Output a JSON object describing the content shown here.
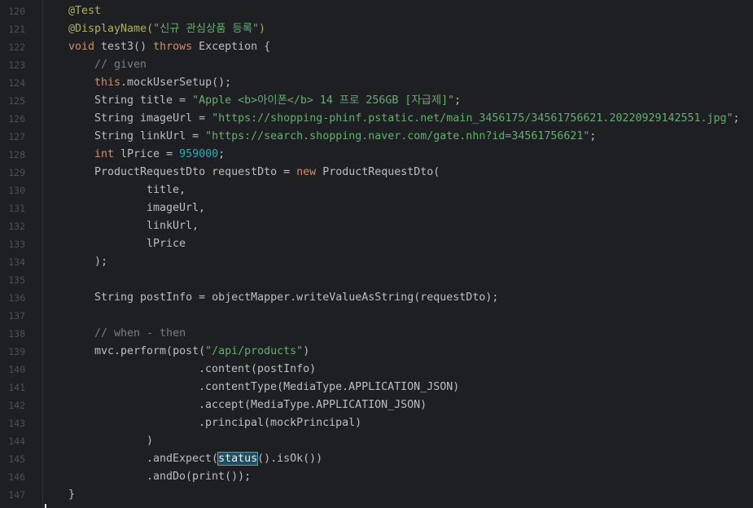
{
  "editor": {
    "line_numbers": [
      "120",
      "121",
      "122",
      "123",
      "124",
      "125",
      "126",
      "127",
      "128",
      "129",
      "130",
      "131",
      "132",
      "133",
      "134",
      "135",
      "136",
      "137",
      "138",
      "139",
      "140",
      "141",
      "142",
      "143",
      "144",
      "145",
      "146",
      "147"
    ],
    "lines": [
      {
        "indent": 0,
        "tokens": [
          {
            "t": "@Test",
            "c": "ann"
          }
        ]
      },
      {
        "indent": 0,
        "tokens": [
          {
            "t": "@DisplayName(",
            "c": "ann"
          },
          {
            "t": "\"신규 관심상품 등록\"",
            "c": "str"
          },
          {
            "t": ")",
            "c": "ann"
          }
        ]
      },
      {
        "indent": 0,
        "tokens": [
          {
            "t": "void ",
            "c": "kw"
          },
          {
            "t": "test3() ",
            "c": "plain"
          },
          {
            "t": "throws ",
            "c": "kw"
          },
          {
            "t": "Exception {",
            "c": "plain"
          }
        ]
      },
      {
        "indent": 1,
        "tokens": [
          {
            "t": "// given",
            "c": "cmt"
          }
        ]
      },
      {
        "indent": 1,
        "tokens": [
          {
            "t": "this",
            "c": "kw"
          },
          {
            "t": ".mockUserSetup();",
            "c": "plain"
          }
        ]
      },
      {
        "indent": 1,
        "tokens": [
          {
            "t": "String title = ",
            "c": "plain"
          },
          {
            "t": "\"Apple <b>아이폰</b> 14 프로 256GB [자급제]\"",
            "c": "str"
          },
          {
            "t": ";",
            "c": "plain"
          }
        ]
      },
      {
        "indent": 1,
        "tokens": [
          {
            "t": "String imageUrl = ",
            "c": "plain"
          },
          {
            "t": "\"https://shopping-phinf.pstatic.net/main_3456175/34561756621.20220929142551.jpg\"",
            "c": "str"
          },
          {
            "t": ";",
            "c": "plain"
          }
        ]
      },
      {
        "indent": 1,
        "tokens": [
          {
            "t": "String linkUrl = ",
            "c": "plain"
          },
          {
            "t": "\"https://search.shopping.naver.com/gate.nhn?id=34561756621\"",
            "c": "str"
          },
          {
            "t": ";",
            "c": "plain"
          }
        ]
      },
      {
        "indent": 1,
        "tokens": [
          {
            "t": "int ",
            "c": "kw"
          },
          {
            "t": "lPrice = ",
            "c": "plain"
          },
          {
            "t": "959000",
            "c": "num"
          },
          {
            "t": ";",
            "c": "plain"
          }
        ]
      },
      {
        "indent": 1,
        "tokens": [
          {
            "t": "ProductRequestDto requestDto = ",
            "c": "plain"
          },
          {
            "t": "new ",
            "c": "kw"
          },
          {
            "t": "ProductRequestDto(",
            "c": "plain"
          }
        ]
      },
      {
        "indent": 3,
        "tokens": [
          {
            "t": "title,",
            "c": "plain"
          }
        ]
      },
      {
        "indent": 3,
        "tokens": [
          {
            "t": "imageUrl,",
            "c": "plain"
          }
        ]
      },
      {
        "indent": 3,
        "tokens": [
          {
            "t": "linkUrl,",
            "c": "plain"
          }
        ]
      },
      {
        "indent": 3,
        "tokens": [
          {
            "t": "lPrice",
            "c": "plain"
          }
        ]
      },
      {
        "indent": 1,
        "tokens": [
          {
            "t": ");",
            "c": "plain"
          }
        ]
      },
      {
        "indent": 0,
        "tokens": []
      },
      {
        "indent": 1,
        "tokens": [
          {
            "t": "String postInfo = objectMapper.writeValueAsString(requestDto);",
            "c": "plain"
          }
        ]
      },
      {
        "indent": 0,
        "tokens": []
      },
      {
        "indent": 1,
        "tokens": [
          {
            "t": "// when - then",
            "c": "cmt"
          }
        ]
      },
      {
        "indent": 1,
        "tokens": [
          {
            "t": "mvc.perform(post(",
            "c": "plain"
          },
          {
            "t": "\"/api/products\"",
            "c": "str"
          },
          {
            "t": ")",
            "c": "plain"
          }
        ]
      },
      {
        "indent": 5,
        "tokens": [
          {
            "t": ".content(postInfo)",
            "c": "plain"
          }
        ]
      },
      {
        "indent": 5,
        "tokens": [
          {
            "t": ".contentType(MediaType.APPLICATION_JSON)",
            "c": "plain"
          }
        ]
      },
      {
        "indent": 5,
        "tokens": [
          {
            "t": ".accept(MediaType.APPLICATION_JSON)",
            "c": "plain"
          }
        ]
      },
      {
        "indent": 5,
        "tokens": [
          {
            "t": ".principal(mockPrincipal)",
            "c": "plain"
          }
        ]
      },
      {
        "indent": 3,
        "tokens": [
          {
            "t": ")",
            "c": "plain"
          }
        ]
      },
      {
        "indent": 3,
        "tokens": [
          {
            "t": ".andExpect(",
            "c": "plain"
          },
          {
            "t": "status",
            "c": "hl"
          },
          {
            "t": "().isOk())",
            "c": "plain"
          }
        ]
      },
      {
        "indent": 3,
        "tokens": [
          {
            "t": ".andDo(print());",
            "c": "plain"
          }
        ]
      },
      {
        "indent": 0,
        "tokens": [
          {
            "t": "}",
            "c": "plain"
          }
        ]
      }
    ]
  }
}
